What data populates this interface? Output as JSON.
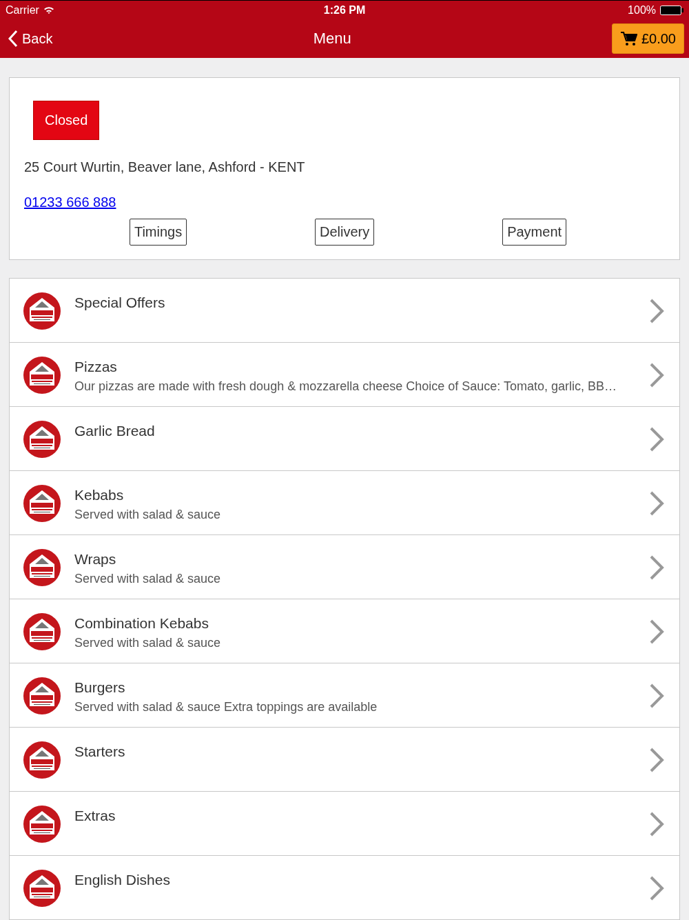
{
  "status_bar": {
    "carrier": "Carrier",
    "time": "1:26 PM",
    "battery": "100%"
  },
  "nav": {
    "back": "Back",
    "title": "Menu",
    "cart": "£0.00"
  },
  "shop": {
    "status": "Closed",
    "open": false,
    "address": "25 Court Wurtin, Beaver lane, Ashford - KENT",
    "phone": "01233 666 888",
    "buttons": [
      "Timings",
      "Delivery",
      "Payment"
    ]
  },
  "categories": [
    {
      "name": "Special Offers"
    },
    {
      "name": "Pizzas",
      "description": "Our pizzas are made with fresh dough & mozzarella cheese Choice of Sauce: Tomato, garlic, BB…"
    },
    {
      "name": "Garlic Bread"
    },
    {
      "name": "Kebabs",
      "description": "Served with salad & sauce"
    },
    {
      "name": "Wraps",
      "description": "Served with salad & sauce"
    },
    {
      "name": "Combination Kebabs",
      "description": "Served with salad & sauce"
    },
    {
      "name": "Burgers",
      "description": "Served with salad & sauce Extra toppings are available"
    },
    {
      "name": "Starters"
    },
    {
      "name": "Extras"
    },
    {
      "name": "English Dishes"
    }
  ]
}
